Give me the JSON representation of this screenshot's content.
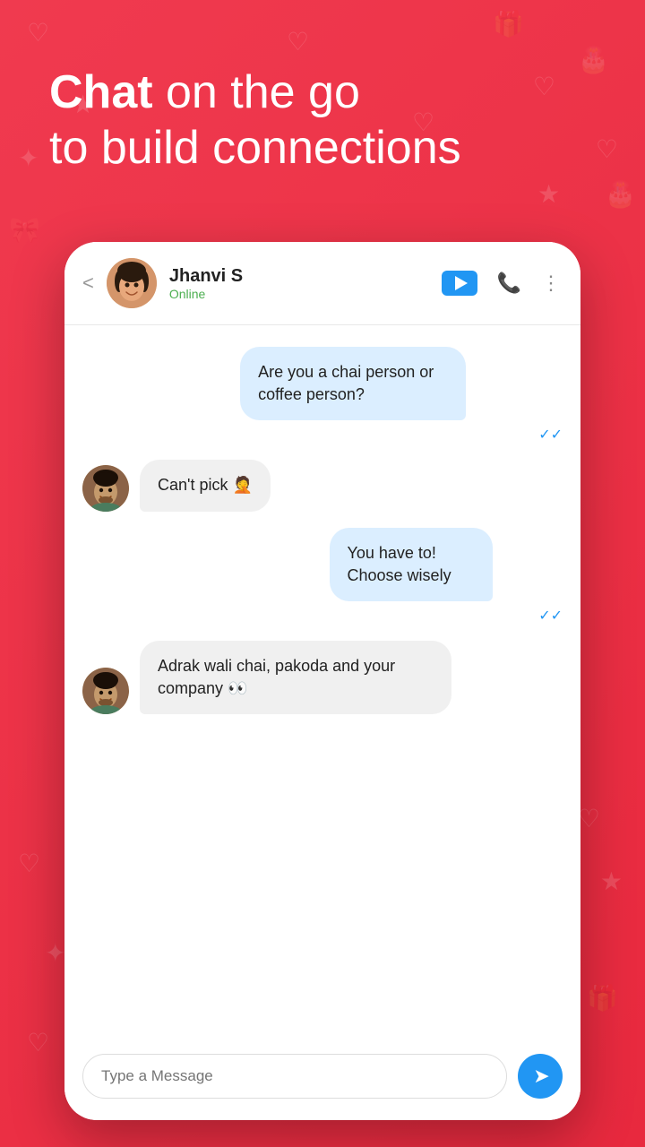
{
  "hero": {
    "line1_bold": "Chat",
    "line1_rest": " on the go",
    "line2": "to build connections"
  },
  "header": {
    "back_label": "<",
    "contact_name": "Jhanvi S",
    "status": "Online",
    "more_label": "⋮"
  },
  "messages": [
    {
      "id": "msg1",
      "type": "sent",
      "text": "Are you a chai person or coffee person?",
      "receipt": "✓✓"
    },
    {
      "id": "msg2",
      "type": "received",
      "text": "Can't pick 🤦",
      "has_avatar": true
    },
    {
      "id": "msg3",
      "type": "sent",
      "text": "You have to! Choose wisely",
      "receipt": "✓✓"
    },
    {
      "id": "msg4",
      "type": "received",
      "text": "Adrak wali chai, pakoda and your company 👀",
      "has_avatar": true
    }
  ],
  "input": {
    "placeholder": "Type a Message",
    "send_label": "➤"
  }
}
